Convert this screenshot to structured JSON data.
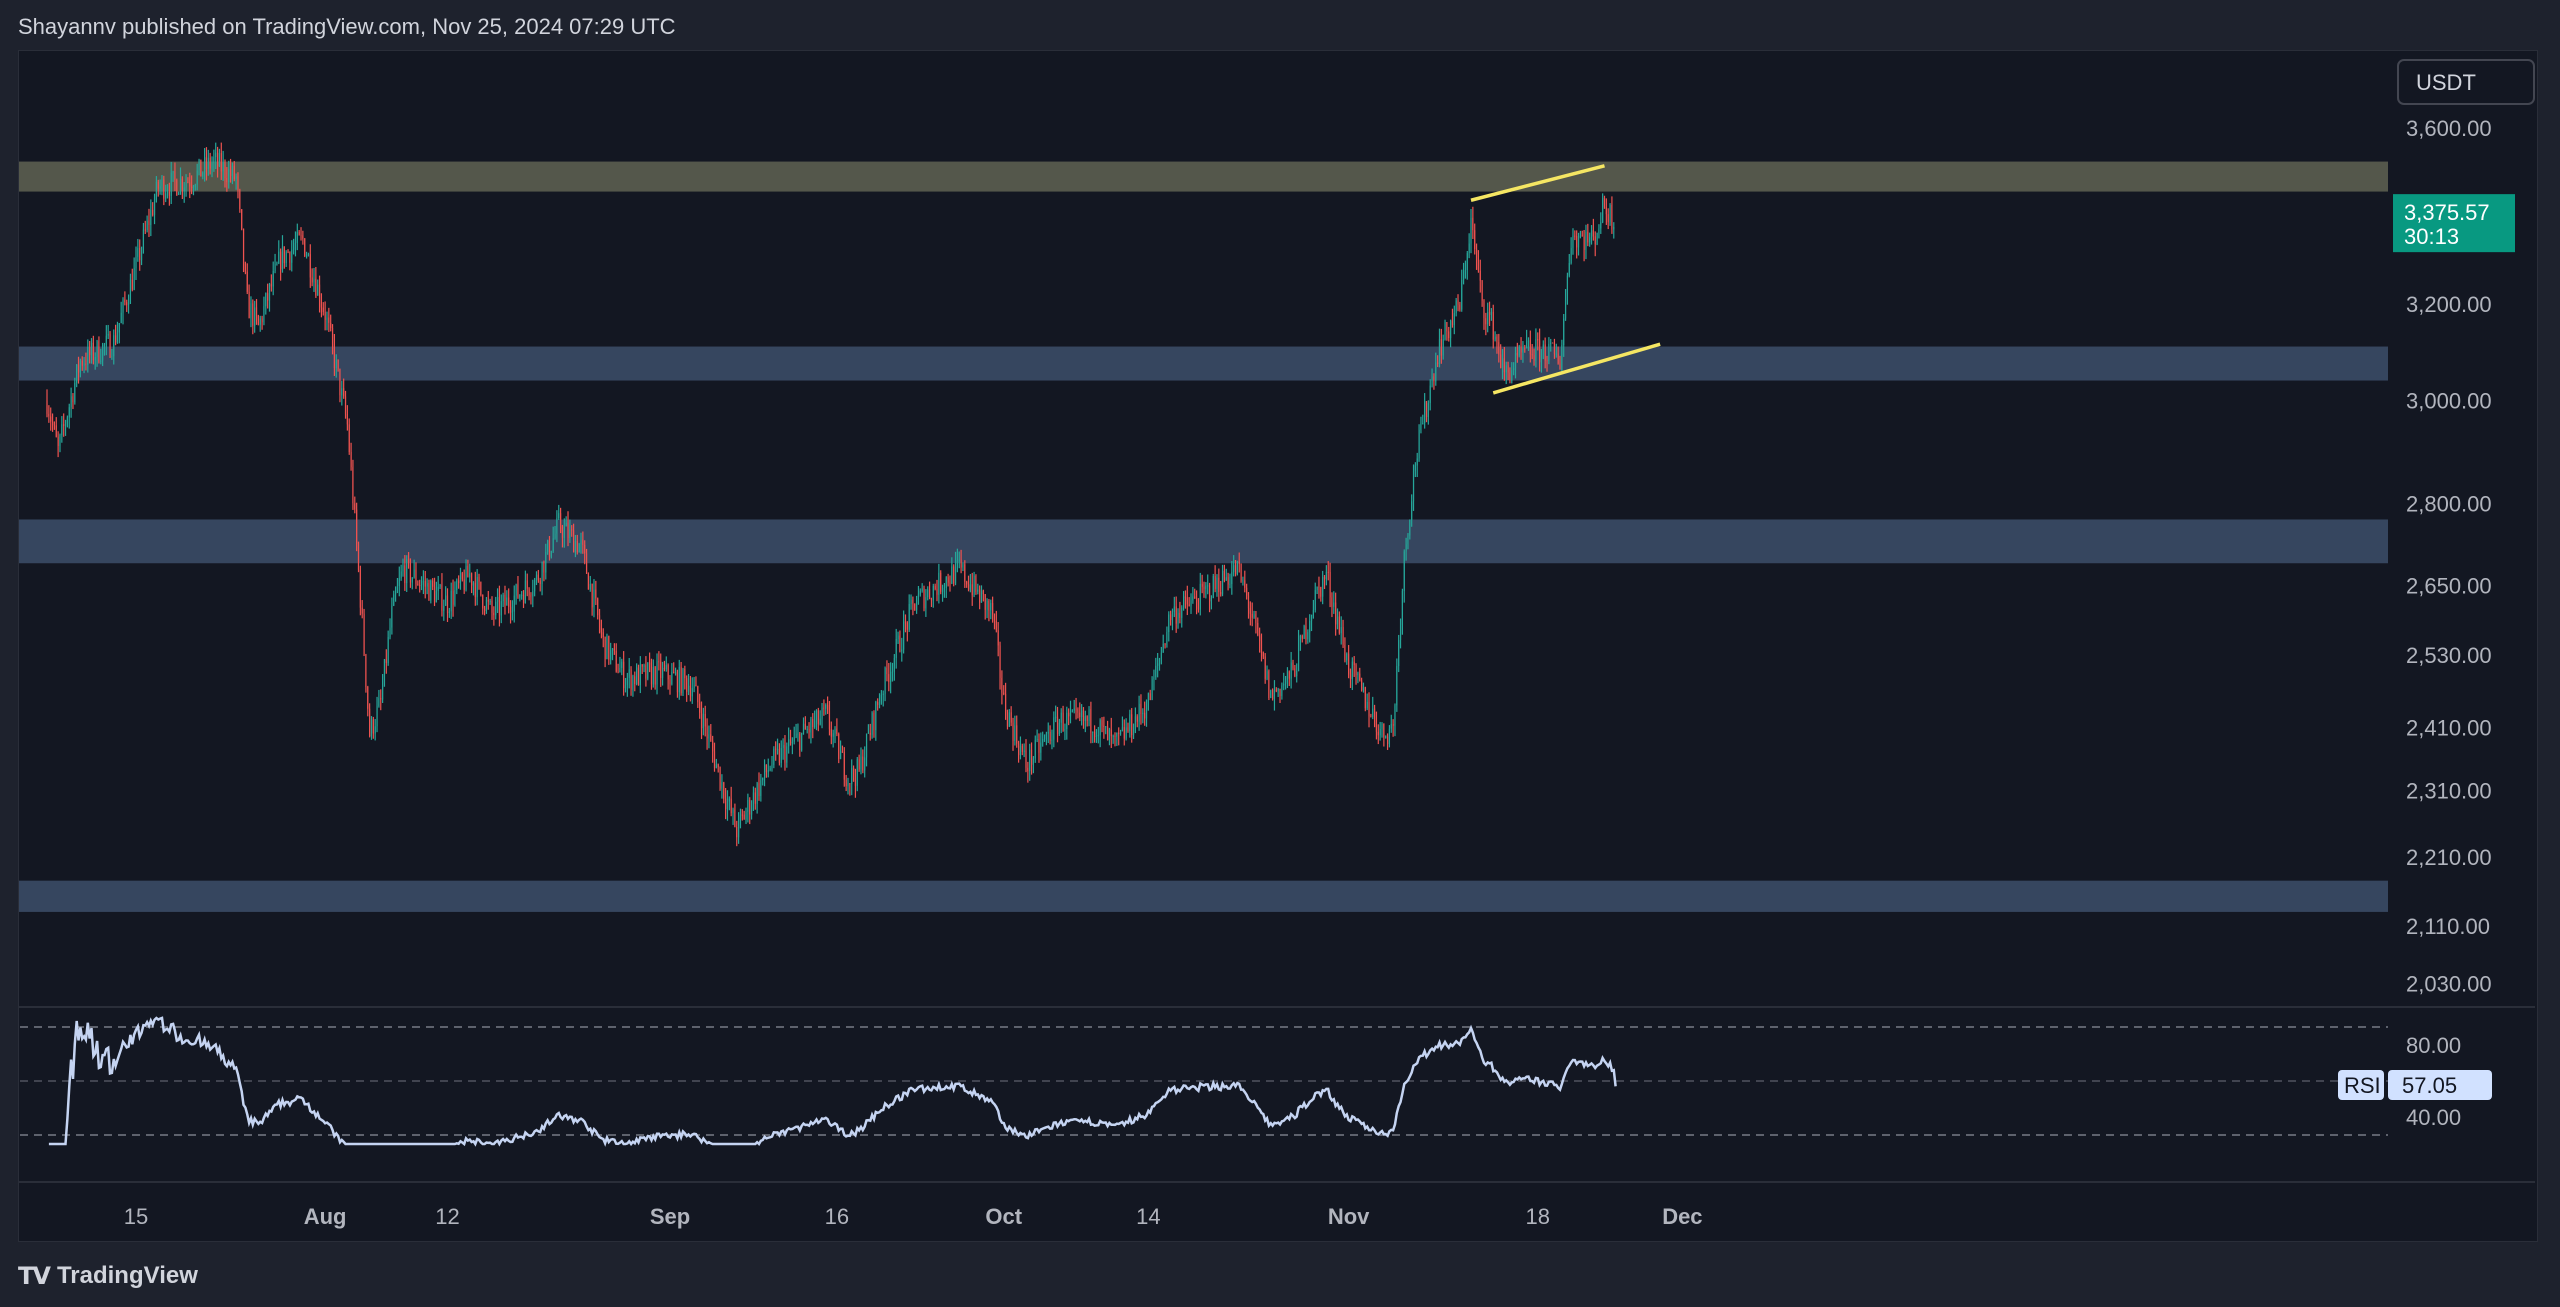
{
  "header": {
    "publisher_text": "Shayannv published on TradingView.com, Nov 25, 2024 07:29 UTC"
  },
  "footer": {
    "brand": "TradingView",
    "logo_glyph": "𝟏𝟕"
  },
  "colors": {
    "background": "#131722",
    "up_candle": "#26a69a",
    "down_candle": "#ef5350",
    "support_zone": "#3b4b66",
    "resistance_zone": "#5c5e50",
    "wedge_line": "#f5e663",
    "rsi_line": "#c5d4f2",
    "price_tag": "#089981"
  },
  "chart_data": {
    "type": "candlestick",
    "currency_label": "USDT",
    "price_axis_ticks": [
      "3,600.00",
      "3,200.00",
      "3,000.00",
      "2,800.00",
      "2,650.00",
      "2,530.00",
      "2,410.00",
      "2,310.00",
      "2,210.00",
      "2,110.00",
      "2,030.00"
    ],
    "x_tick_labels": [
      "15",
      "Aug",
      "12",
      "Sep",
      "16",
      "Oct",
      "14",
      "Nov",
      "18",
      "Dec"
    ],
    "current_price": {
      "value": "3,375.57",
      "countdown": "30:13"
    },
    "zones": [
      {
        "type": "resistance",
        "from": 3450,
        "to": 3520
      },
      {
        "type": "support",
        "from": 3040,
        "to": 3110
      },
      {
        "type": "support",
        "from": 2690,
        "to": 2770
      },
      {
        "type": "support",
        "from": 2130,
        "to": 2175
      }
    ],
    "wedge": {
      "upper": [
        [
          "Nov 12",
          3430
        ],
        [
          "Nov 24",
          3510
        ]
      ],
      "lower": [
        [
          "Nov 14",
          3015
        ],
        [
          "Nov 29",
          3115
        ]
      ]
    },
    "price_keypoints": [
      [
        "Jul 7",
        3000
      ],
      [
        "Jul 8",
        2900
      ],
      [
        "Jul 10",
        3080
      ],
      [
        "Jul 13",
        3120
      ],
      [
        "Jul 15",
        3280
      ],
      [
        "Jul 17",
        3460
      ],
      [
        "Jul 20",
        3480
      ],
      [
        "Jul 22",
        3520
      ],
      [
        "Jul 24",
        3480
      ],
      [
        "Jul 25",
        3200
      ],
      [
        "Jul 26",
        3150
      ],
      [
        "Jul 28",
        3300
      ],
      [
        "Jul 30",
        3340
      ],
      [
        "Aug 1",
        3180
      ],
      [
        "Aug 3",
        2950
      ],
      [
        "Aug 5",
        2400
      ],
      [
        "Aug 6",
        2450
      ],
      [
        "Aug 7",
        2600
      ],
      [
        "Aug 8",
        2680
      ],
      [
        "Aug 12",
        2620
      ],
      [
        "Aug 14",
        2670
      ],
      [
        "Aug 16",
        2600
      ],
      [
        "Aug 20",
        2660
      ],
      [
        "Aug 22",
        2760
      ],
      [
        "Aug 24",
        2720
      ],
      [
        "Aug 26",
        2550
      ],
      [
        "Aug 28",
        2490
      ],
      [
        "Aug 31",
        2500
      ],
      [
        "Sep 3",
        2480
      ],
      [
        "Sep 6",
        2300
      ],
      [
        "Sep 7",
        2250
      ],
      [
        "Sep 10",
        2350
      ],
      [
        "Sep 13",
        2400
      ],
      [
        "Sep 15",
        2430
      ],
      [
        "Sep 17",
        2330
      ],
      [
        "Sep 18",
        2340
      ],
      [
        "Sep 20",
        2470
      ],
      [
        "Sep 23",
        2620
      ],
      [
        "Sep 25",
        2650
      ],
      [
        "Sep 27",
        2680
      ],
      [
        "Sep 30",
        2600
      ],
      [
        "Oct 1",
        2450
      ],
      [
        "Oct 3",
        2350
      ],
      [
        "Oct 6",
        2420
      ],
      [
        "Oct 9",
        2420
      ],
      [
        "Oct 11",
        2380
      ],
      [
        "Oct 14",
        2450
      ],
      [
        "Oct 16",
        2600
      ],
      [
        "Oct 18",
        2620
      ],
      [
        "Oct 20",
        2650
      ],
      [
        "Oct 22",
        2680
      ],
      [
        "Oct 23",
        2620
      ],
      [
        "Oct 25",
        2460
      ],
      [
        "Oct 27",
        2500
      ],
      [
        "Oct 29",
        2630
      ],
      [
        "Oct 30",
        2670
      ],
      [
        "Nov 1",
        2510
      ],
      [
        "Nov 4",
        2400
      ],
      [
        "Nov 5",
        2410
      ],
      [
        "Nov 6",
        2700
      ],
      [
        "Nov 7",
        2880
      ],
      [
        "Nov 9",
        3100
      ],
      [
        "Nov 11",
        3200
      ],
      [
        "Nov 12",
        3380
      ],
      [
        "Nov 13",
        3200
      ],
      [
        "Nov 14",
        3150
      ],
      [
        "Nov 15",
        3050
      ],
      [
        "Nov 17",
        3100
      ],
      [
        "Nov 19",
        3100
      ],
      [
        "Nov 20",
        3080
      ],
      [
        "Nov 21",
        3350
      ],
      [
        "Nov 23",
        3340
      ],
      [
        "Nov 24",
        3420
      ],
      [
        "Nov 25",
        3376
      ]
    ],
    "rsi": {
      "label": "RSI",
      "value": "57.05",
      "levels": [
        80,
        40
      ],
      "level_labels": [
        "80.00",
        "40.00"
      ]
    }
  }
}
